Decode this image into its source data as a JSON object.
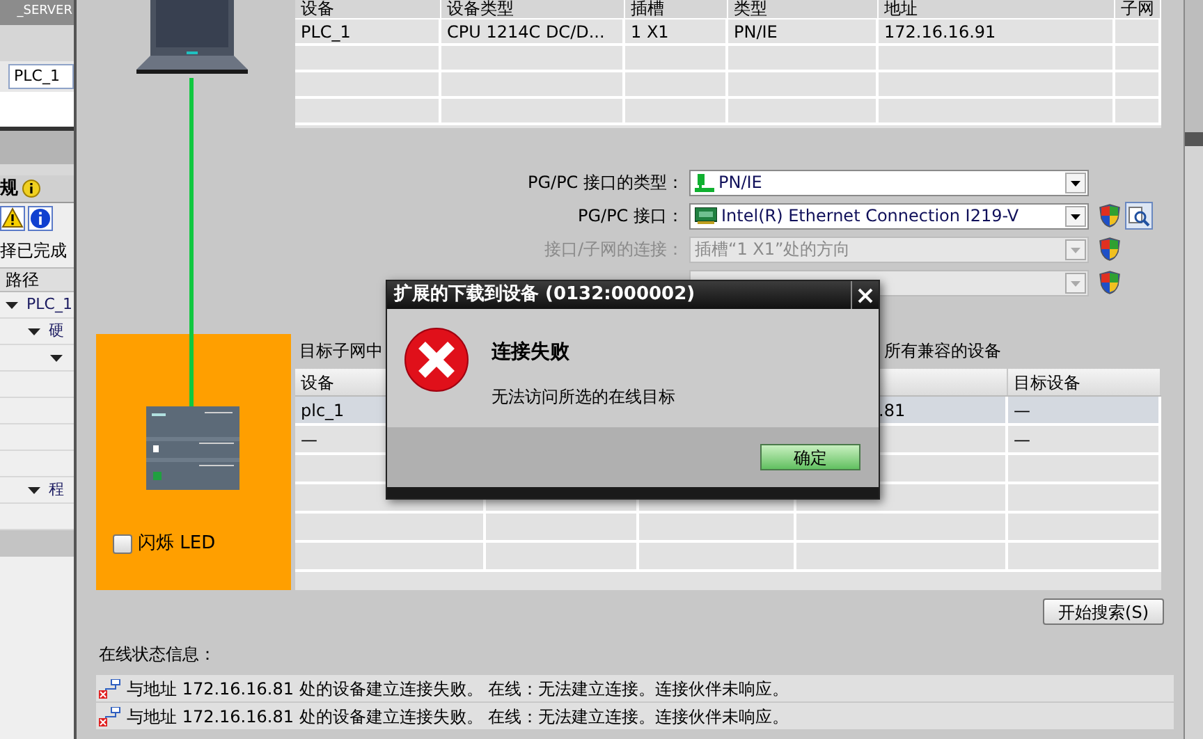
{
  "left_panel": {
    "header": "_SERVER",
    "name_field": "PLC_1",
    "tab": "规",
    "status_text": "择已完成",
    "tree_header": "路径",
    "tree": [
      {
        "label": "PLC_1",
        "expanded": true,
        "children": [
          {
            "label": "硬",
            "expanded": true,
            "children": [
              {
                "expanded": true
              }
            ]
          },
          {
            "label": "程",
            "expanded": true
          }
        ]
      }
    ]
  },
  "topology": {
    "led_label": "闪烁 LED",
    "led_checked": false
  },
  "device_table": {
    "columns": [
      "设备",
      "设备类型",
      "插槽",
      "类型",
      "地址",
      "子网"
    ],
    "rows": [
      [
        "PLC_1",
        "CPU 1214C DC/D...",
        "1 X1",
        "PN/IE",
        "172.16.16.91"
      ]
    ]
  },
  "connection_form": [
    {
      "label": "PG/PC 接口的类型：",
      "value": "PN/IE",
      "disabled": false
    },
    {
      "label": "PG/PC 接口：",
      "value": "Intel(R) Ethernet Connection I219-V",
      "disabled": false
    },
    {
      "label": "接口/子网的连接：",
      "value": "插槽“1 X1”处的方向",
      "disabled": true
    },
    {
      "disabled": true
    }
  ],
  "target_text_left": "目标子网中",
  "target_text_right": "所有兼容的设备",
  "target_table": {
    "columns": [
      "设备",
      "目标设备"
    ],
    "rows": [
      {
        "device": "plc_1",
        "address": ".81",
        "target": "—",
        "selected": true
      },
      {
        "device": "—",
        "target": "—",
        "selected": false
      }
    ]
  },
  "search_button": "开始搜索(S)",
  "status": {
    "title": "在线状态信息：",
    "messages": [
      "与地址 172.16.16.81 处的设备建立连接失败。 在线：无法建立连接。连接伙伴未响应。",
      "与地址 172.16.16.81 处的设备建立连接失败。 在线：无法建立连接。连接伙伴未响应。"
    ]
  },
  "dialog": {
    "title": "扩展的下载到设备 (0132:000002)",
    "heading": "连接失败",
    "message": "无法访问所选的在线目标",
    "ok_button": "确定"
  }
}
